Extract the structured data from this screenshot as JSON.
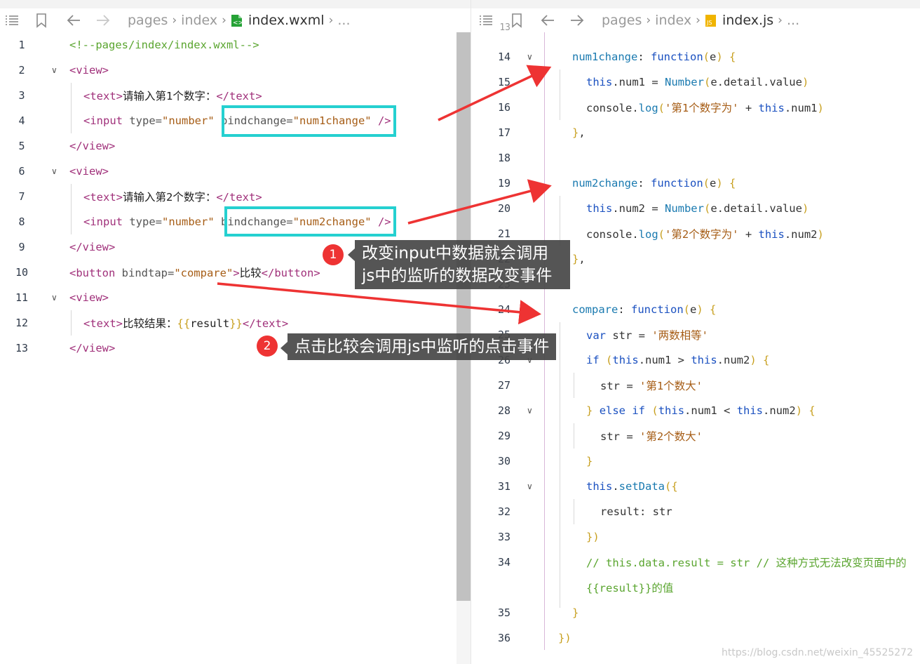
{
  "left_editor": {
    "breadcrumb": {
      "part1": "pages",
      "part2": "index",
      "file": "index.wxml",
      "more": "..."
    },
    "lines": [
      {
        "n": "1",
        "fold": false,
        "ind": 0,
        "parts": [
          [
            "cmt",
            "<!--pages/index/index.wxml-->"
          ]
        ]
      },
      {
        "n": "2",
        "fold": true,
        "ind": 0,
        "parts": [
          [
            "tag",
            "<view>"
          ]
        ]
      },
      {
        "n": "3",
        "fold": false,
        "ind": 1,
        "parts": [
          [
            "tag",
            "<text>"
          ],
          [
            "txt",
            "请输入第1个数字："
          ],
          [
            "tag",
            "</text>"
          ]
        ]
      },
      {
        "n": "4",
        "fold": false,
        "ind": 1,
        "parts": [
          [
            "tag",
            "<input "
          ],
          [
            "attr",
            "type="
          ],
          [
            "str",
            "\"number\""
          ],
          [
            "attr",
            " bindchange="
          ],
          [
            "str",
            "\"num1change\""
          ],
          [
            "tag",
            " />"
          ]
        ]
      },
      {
        "n": "5",
        "fold": false,
        "ind": 0,
        "parts": [
          [
            "tag",
            "</view>"
          ]
        ]
      },
      {
        "n": "6",
        "fold": true,
        "ind": 0,
        "parts": [
          [
            "tag",
            "<view>"
          ]
        ]
      },
      {
        "n": "7",
        "fold": false,
        "ind": 1,
        "parts": [
          [
            "tag",
            "<text>"
          ],
          [
            "txt",
            "请输入第2个数字："
          ],
          [
            "tag",
            "</text>"
          ]
        ]
      },
      {
        "n": "8",
        "fold": false,
        "ind": 1,
        "parts": [
          [
            "tag",
            "<input "
          ],
          [
            "attr",
            "type="
          ],
          [
            "str",
            "\"number\""
          ],
          [
            "attr",
            " bindchange="
          ],
          [
            "str",
            "\"num2change\""
          ],
          [
            "tag",
            " />"
          ]
        ]
      },
      {
        "n": "9",
        "fold": false,
        "ind": 0,
        "parts": [
          [
            "tag",
            "</view>"
          ]
        ]
      },
      {
        "n": "10",
        "fold": false,
        "ind": 0,
        "parts": [
          [
            "tag",
            "<button "
          ],
          [
            "attr",
            "bindtap="
          ],
          [
            "str",
            "\"compare\""
          ],
          [
            "tag",
            ">"
          ],
          [
            "txt",
            "比较"
          ],
          [
            "tag",
            "</button>"
          ]
        ]
      },
      {
        "n": "11",
        "fold": true,
        "ind": 0,
        "parts": [
          [
            "tag",
            "<view>"
          ]
        ]
      },
      {
        "n": "12",
        "fold": false,
        "ind": 1,
        "parts": [
          [
            "tag",
            "<text>"
          ],
          [
            "txt",
            "比较结果："
          ],
          [
            "punc",
            "{{"
          ],
          [
            "txt",
            "result"
          ],
          [
            "punc",
            "}}"
          ],
          [
            "tag",
            "</text>"
          ]
        ]
      },
      {
        "n": "13",
        "fold": false,
        "ind": 0,
        "parts": [
          [
            "tag",
            "</view>"
          ]
        ]
      }
    ]
  },
  "right_editor": {
    "breadcrumb": {
      "part1": "pages",
      "part2": "index",
      "file": "index.js",
      "more": "..."
    },
    "top_partial_line": "13",
    "lines": [
      {
        "n": "14",
        "fold": true,
        "ind": 1,
        "parts": [
          [
            "fn",
            "num1change"
          ],
          [
            "prop",
            ": "
          ],
          [
            "kw",
            "function"
          ],
          [
            "punc",
            "("
          ],
          [
            "prop",
            "e"
          ],
          [
            "punc",
            ")"
          ],
          [
            "prop",
            " "
          ],
          [
            "punc",
            "{"
          ]
        ]
      },
      {
        "n": "15",
        "fold": false,
        "ind": 2,
        "parts": [
          [
            "kw",
            "this"
          ],
          [
            "prop",
            ".num1 = "
          ],
          [
            "fn",
            "Number"
          ],
          [
            "punc",
            "("
          ],
          [
            "prop",
            "e.detail.value"
          ],
          [
            "punc",
            ")"
          ]
        ]
      },
      {
        "n": "16",
        "fold": false,
        "ind": 2,
        "parts": [
          [
            "prop",
            "console."
          ],
          [
            "fn",
            "log"
          ],
          [
            "punc",
            "("
          ],
          [
            "str",
            "'第1个数字为'"
          ],
          [
            "prop",
            " + "
          ],
          [
            "kw",
            "this"
          ],
          [
            "prop",
            ".num1"
          ],
          [
            "punc",
            ")"
          ]
        ]
      },
      {
        "n": "17",
        "fold": false,
        "ind": 1,
        "parts": [
          [
            "punc",
            "}"
          ],
          [
            "prop",
            ","
          ]
        ]
      },
      {
        "n": "18",
        "fold": false,
        "ind": 1,
        "parts": []
      },
      {
        "n": "19",
        "fold": true,
        "ind": 1,
        "parts": [
          [
            "fn",
            "num2change"
          ],
          [
            "prop",
            ": "
          ],
          [
            "kw",
            "function"
          ],
          [
            "punc",
            "("
          ],
          [
            "prop",
            "e"
          ],
          [
            "punc",
            ")"
          ],
          [
            "prop",
            " "
          ],
          [
            "punc",
            "{"
          ]
        ]
      },
      {
        "n": "20",
        "fold": false,
        "ind": 2,
        "parts": [
          [
            "kw",
            "this"
          ],
          [
            "prop",
            ".num2 = "
          ],
          [
            "fn",
            "Number"
          ],
          [
            "punc",
            "("
          ],
          [
            "prop",
            "e.detail.value"
          ],
          [
            "punc",
            ")"
          ]
        ]
      },
      {
        "n": "21",
        "fold": false,
        "ind": 2,
        "parts": [
          [
            "prop",
            "console."
          ],
          [
            "fn",
            "log"
          ],
          [
            "punc",
            "("
          ],
          [
            "str",
            "'第2个数字为'"
          ],
          [
            "prop",
            " + "
          ],
          [
            "kw",
            "this"
          ],
          [
            "prop",
            ".num2"
          ],
          [
            "punc",
            ")"
          ]
        ]
      },
      {
        "n": "22",
        "fold": false,
        "ind": 1,
        "parts": [
          [
            "punc",
            "}"
          ],
          [
            "prop",
            ","
          ]
        ]
      },
      {
        "n": "23",
        "fold": false,
        "ind": 1,
        "parts": []
      },
      {
        "n": "24",
        "fold": true,
        "ind": 1,
        "parts": [
          [
            "fn",
            "compare"
          ],
          [
            "prop",
            ": "
          ],
          [
            "kw",
            "function"
          ],
          [
            "punc",
            "("
          ],
          [
            "prop",
            "e"
          ],
          [
            "punc",
            ")"
          ],
          [
            "prop",
            " "
          ],
          [
            "punc",
            "{"
          ]
        ]
      },
      {
        "n": "25",
        "fold": false,
        "ind": 2,
        "parts": [
          [
            "kw",
            "var"
          ],
          [
            "prop",
            " str = "
          ],
          [
            "str",
            "'两数相等'"
          ]
        ]
      },
      {
        "n": "26",
        "fold": true,
        "ind": 2,
        "parts": [
          [
            "kw",
            "if"
          ],
          [
            "prop",
            " "
          ],
          [
            "punc",
            "("
          ],
          [
            "kw",
            "this"
          ],
          [
            "prop",
            ".num1 > "
          ],
          [
            "kw",
            "this"
          ],
          [
            "prop",
            ".num2"
          ],
          [
            "punc",
            ")"
          ],
          [
            "prop",
            " "
          ],
          [
            "punc",
            "{"
          ]
        ]
      },
      {
        "n": "27",
        "fold": false,
        "ind": 3,
        "parts": [
          [
            "prop",
            "str = "
          ],
          [
            "str",
            "'第1个数大'"
          ]
        ]
      },
      {
        "n": "28",
        "fold": true,
        "ind": 2,
        "parts": [
          [
            "punc",
            "}"
          ],
          [
            "prop",
            " "
          ],
          [
            "kw",
            "else if"
          ],
          [
            "prop",
            " "
          ],
          [
            "punc",
            "("
          ],
          [
            "kw",
            "this"
          ],
          [
            "prop",
            ".num1 < "
          ],
          [
            "kw",
            "this"
          ],
          [
            "prop",
            ".num2"
          ],
          [
            "punc",
            ")"
          ],
          [
            "prop",
            " "
          ],
          [
            "punc",
            "{"
          ]
        ]
      },
      {
        "n": "29",
        "fold": false,
        "ind": 3,
        "parts": [
          [
            "prop",
            "str = "
          ],
          [
            "str",
            "'第2个数大'"
          ]
        ]
      },
      {
        "n": "30",
        "fold": false,
        "ind": 2,
        "parts": [
          [
            "punc",
            "}"
          ]
        ]
      },
      {
        "n": "31",
        "fold": true,
        "ind": 2,
        "parts": [
          [
            "kw",
            "this"
          ],
          [
            "prop",
            "."
          ],
          [
            "fn",
            "setData"
          ],
          [
            "punc",
            "({"
          ]
        ]
      },
      {
        "n": "32",
        "fold": false,
        "ind": 3,
        "parts": [
          [
            "prop",
            "result: str"
          ]
        ]
      },
      {
        "n": "33",
        "fold": false,
        "ind": 2,
        "parts": [
          [
            "punc",
            "})"
          ]
        ]
      },
      {
        "n": "34",
        "fold": false,
        "ind": 2,
        "parts": [
          [
            "cmt",
            "// this.data.result = str // 这种方式无法改变页面中的"
          ]
        ]
      },
      {
        "n": "",
        "fold": false,
        "ind": 2,
        "parts": [
          [
            "cmt",
            "{{result}}的值"
          ]
        ]
      },
      {
        "n": "35",
        "fold": false,
        "ind": 1,
        "parts": [
          [
            "punc",
            "}"
          ]
        ]
      },
      {
        "n": "36",
        "fold": false,
        "ind": 0,
        "parts": [
          [
            "punc",
            "})"
          ]
        ]
      }
    ]
  },
  "annotations": {
    "badge1": "1",
    "callout1_line1": "改变input中数据就会调用",
    "callout1_line2": "js中的监听的数据改变事件",
    "badge2": "2",
    "callout2": "点击比较会调用js中监听的点击事件"
  },
  "watermark": "https://blog.csdn.net/weixin_45525272",
  "colors": {
    "highlight_box": "#25d0d0",
    "arrow": "#ee3333",
    "callout_bg": "#464646",
    "tag": "#a0307a",
    "string": "#a65d16",
    "comment": "#5aa52f",
    "keyword": "#1a50c0"
  }
}
